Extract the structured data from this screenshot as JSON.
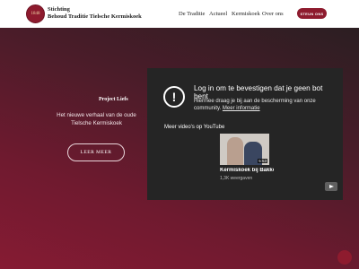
{
  "header": {
    "logo_text": "1848",
    "brand_line1": "Stichting",
    "brand_line2": "Behoud Traditie Tielsche Kermiskoek",
    "nav": [
      "De Traditie",
      "Actueel",
      "Kermiskoek",
      "Over ons"
    ],
    "cta_label": "STEUN ONS"
  },
  "hero": {
    "eyebrow": "Project Liefs",
    "tagline": "Het nieuwe verhaal van de oude Tielsche Kermiskoek",
    "button_label": "LEER MEER"
  },
  "youtube": {
    "warning_title": "Log in om te bevestigen dat je geen bot bent",
    "warning_desc": "Hiermee draag je bij aan de bescherming van onze community.",
    "more_info_link": "Meer informatie",
    "more_videos": "Meer video's op YouTube",
    "video_title": "Kermiskoek bij Bakke...",
    "video_views": "1,3K weergaven",
    "video_duration": "5:53"
  },
  "colors": {
    "brand": "#8e1b2e",
    "hero_dark": "#2b1e22",
    "hero_light": "#861b33",
    "player_bg": "#252525"
  },
  "icons": [
    "logo-seal",
    "warning-icon",
    "youtube-play-icon",
    "chat-icon"
  ]
}
